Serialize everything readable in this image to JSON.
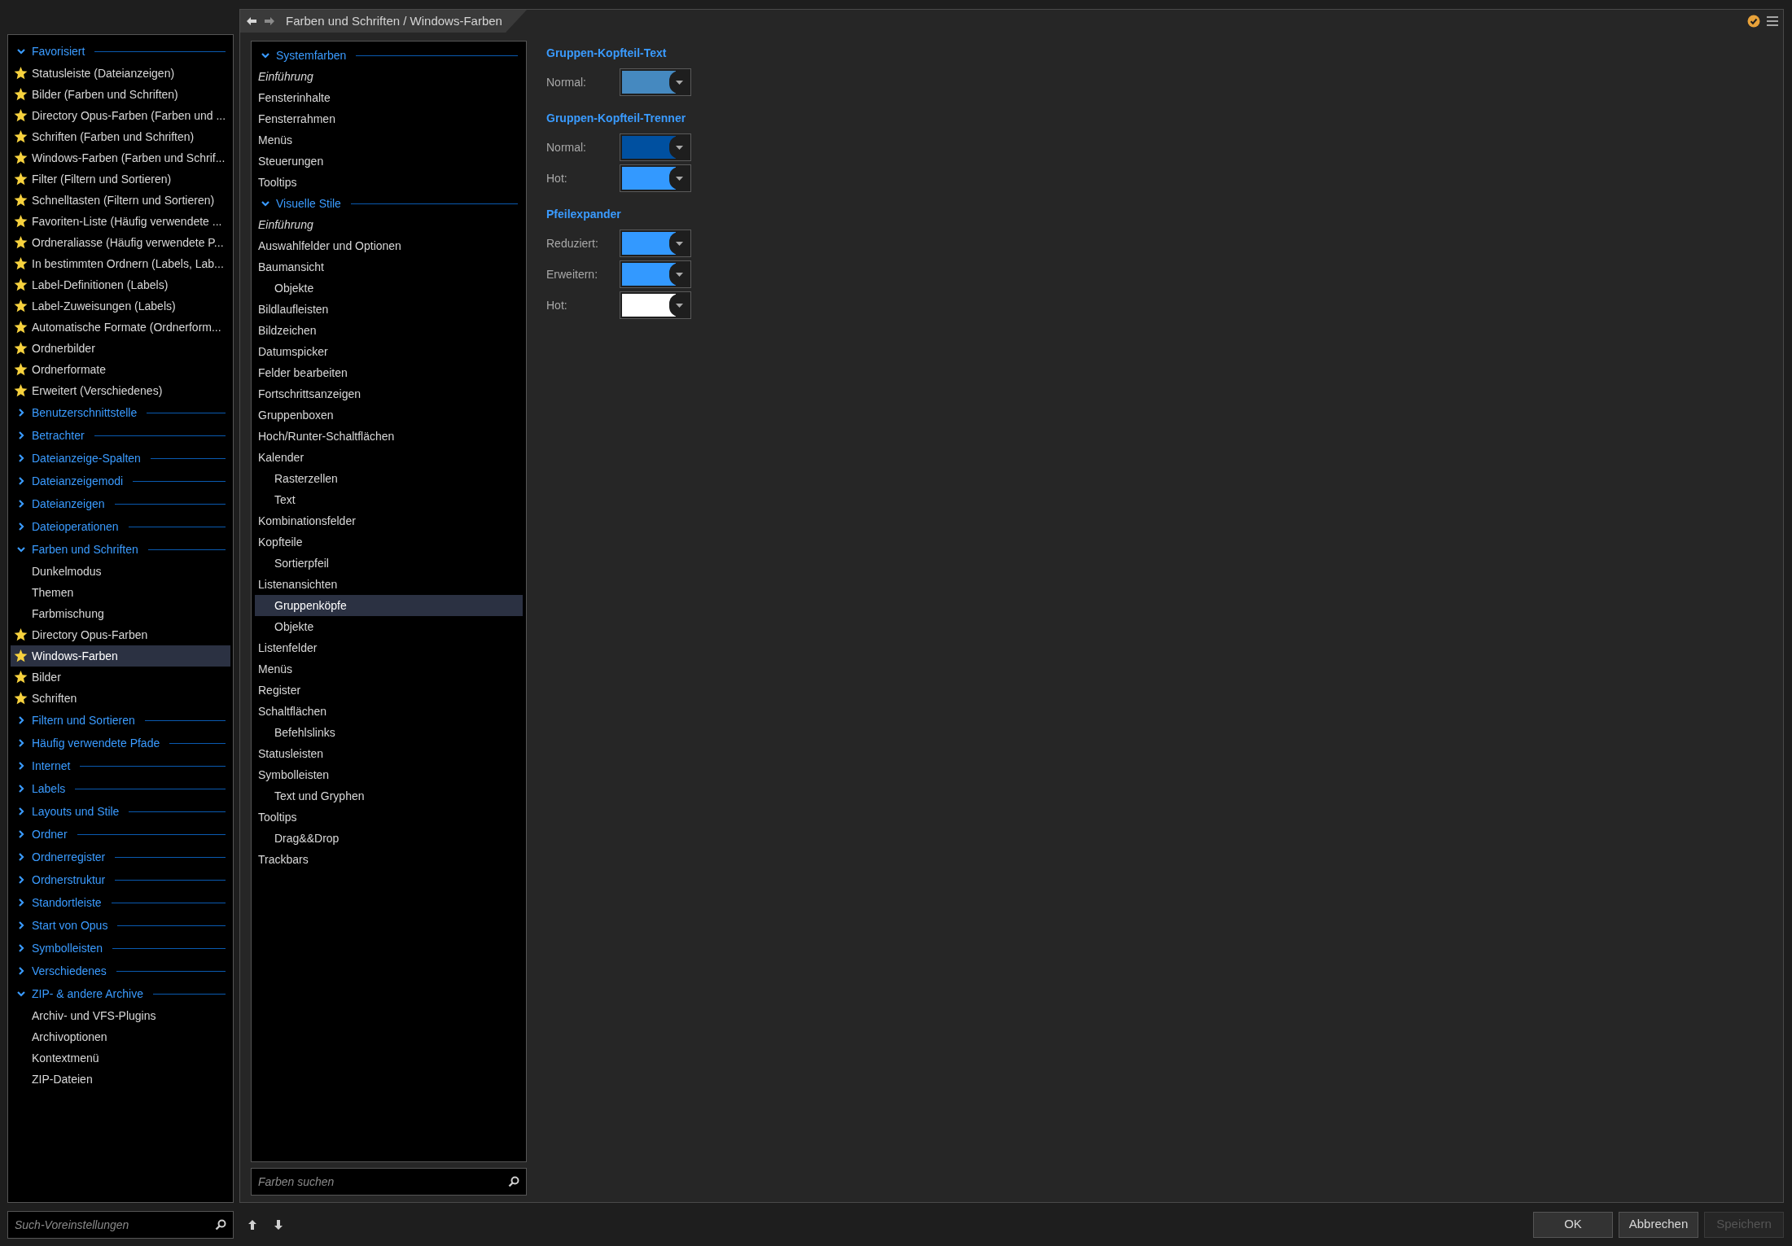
{
  "sidebar": {
    "items": [
      {
        "label": "Favorisiert",
        "expanded": true,
        "children": [
          {
            "label": "Statusleiste (Dateianzeigen)",
            "favorite": true,
            "selected": false
          },
          {
            "label": "Bilder (Farben und Schriften)",
            "favorite": true,
            "selected": false
          },
          {
            "label": "Directory Opus-Farben (Farben und ...",
            "favorite": true,
            "selected": false
          },
          {
            "label": "Schriften (Farben und Schriften)",
            "favorite": true,
            "selected": false
          },
          {
            "label": "Windows-Farben (Farben und Schrif...",
            "favorite": true,
            "selected": false
          },
          {
            "label": "Filter (Filtern und Sortieren)",
            "favorite": true,
            "selected": false
          },
          {
            "label": "Schnelltasten (Filtern und Sortieren)",
            "favorite": true,
            "selected": false
          },
          {
            "label": "Favoriten-Liste (Häufig verwendete ...",
            "favorite": true,
            "selected": false
          },
          {
            "label": "Ordneraliasse (Häufig verwendete P...",
            "favorite": true,
            "selected": false
          },
          {
            "label": "In bestimmten Ordnern (Labels, Lab...",
            "favorite": true,
            "selected": false
          },
          {
            "label": "Label-Definitionen (Labels)",
            "favorite": true,
            "selected": false
          },
          {
            "label": "Label-Zuweisungen (Labels)",
            "favorite": true,
            "selected": false
          },
          {
            "label": "Automatische Formate (Ordnerform...",
            "favorite": true,
            "selected": false
          },
          {
            "label": "Ordnerbilder",
            "favorite": true,
            "selected": false
          },
          {
            "label": "Ordnerformate",
            "favorite": true,
            "selected": false
          },
          {
            "label": "Erweitert (Verschiedenes)",
            "favorite": true,
            "selected": false
          }
        ]
      },
      {
        "label": "Benutzerschnittstelle",
        "expanded": false
      },
      {
        "label": "Betrachter",
        "expanded": false
      },
      {
        "label": "Dateianzeige-Spalten",
        "expanded": false
      },
      {
        "label": "Dateianzeigemodi",
        "expanded": false
      },
      {
        "label": "Dateianzeigen",
        "expanded": false
      },
      {
        "label": "Dateioperationen",
        "expanded": false
      },
      {
        "label": "Farben und Schriften",
        "expanded": true,
        "children": [
          {
            "label": "Dunkelmodus",
            "favorite": false,
            "selected": false
          },
          {
            "label": "Themen",
            "favorite": false,
            "selected": false
          },
          {
            "label": "Farbmischung",
            "favorite": false,
            "selected": false
          },
          {
            "label": "Directory Opus-Farben",
            "favorite": true,
            "selected": false
          },
          {
            "label": "Windows-Farben",
            "favorite": true,
            "selected": true
          },
          {
            "label": "Bilder",
            "favorite": true,
            "selected": false
          },
          {
            "label": "Schriften",
            "favorite": true,
            "selected": false
          }
        ]
      },
      {
        "label": "Filtern und Sortieren",
        "expanded": false
      },
      {
        "label": "Häufig verwendete Pfade",
        "expanded": false
      },
      {
        "label": "Internet",
        "expanded": false
      },
      {
        "label": "Labels",
        "expanded": false
      },
      {
        "label": "Layouts und Stile",
        "expanded": false
      },
      {
        "label": "Ordner",
        "expanded": false
      },
      {
        "label": "Ordnerregister",
        "expanded": false
      },
      {
        "label": "Ordnerstruktur",
        "expanded": false
      },
      {
        "label": "Standortleiste",
        "expanded": false
      },
      {
        "label": "Start von Opus",
        "expanded": false
      },
      {
        "label": "Symbolleisten",
        "expanded": false
      },
      {
        "label": "Verschiedenes",
        "expanded": false
      },
      {
        "label": "ZIP- & andere Archive",
        "expanded": true,
        "children": [
          {
            "label": "Archiv- und VFS-Plugins",
            "favorite": false,
            "selected": false
          },
          {
            "label": "Archivoptionen",
            "favorite": false,
            "selected": false
          },
          {
            "label": "Kontextmenü",
            "favorite": false,
            "selected": false
          },
          {
            "label": "ZIP-Dateien",
            "favorite": false,
            "selected": false
          }
        ]
      }
    ]
  },
  "preset_search": {
    "placeholder": "Such-Voreinstellungen"
  },
  "nav": {
    "back_disabled": false,
    "forward_disabled": true
  },
  "breadcrumb": "Farben und Schriften / Windows-Farben",
  "tree": {
    "items": [
      {
        "label": "Systemfarben",
        "expanded": true,
        "children": [
          {
            "kind": "intro",
            "label": "Einführung",
            "selected": false
          },
          {
            "kind": "page",
            "label": "Fensterinhalte",
            "selected": false
          },
          {
            "kind": "page",
            "label": "Fensterrahmen",
            "selected": false
          },
          {
            "kind": "page",
            "label": "Menüs",
            "selected": false
          },
          {
            "kind": "page",
            "label": "Steuerungen",
            "selected": false
          },
          {
            "kind": "page",
            "label": "Tooltips",
            "selected": false
          }
        ]
      },
      {
        "label": "Visuelle Stile",
        "expanded": true,
        "children": [
          {
            "kind": "intro",
            "label": "Einführung",
            "selected": false
          },
          {
            "kind": "page",
            "label": "Auswahlfelder und Optionen",
            "selected": false
          },
          {
            "kind": "page",
            "label": "Baumansicht",
            "selected": false,
            "children": [
              {
                "kind": "page",
                "label": "Objekte",
                "selected": false
              }
            ]
          },
          {
            "kind": "page",
            "label": "Bildlaufleisten",
            "selected": false
          },
          {
            "kind": "page",
            "label": "Bildzeichen",
            "selected": false
          },
          {
            "kind": "page",
            "label": "Datumspicker",
            "selected": false
          },
          {
            "kind": "page",
            "label": "Felder bearbeiten",
            "selected": false
          },
          {
            "kind": "page",
            "label": "Fortschrittsanzeigen",
            "selected": false
          },
          {
            "kind": "page",
            "label": "Gruppenboxen",
            "selected": false
          },
          {
            "kind": "page",
            "label": "Hoch/Runter-Schaltflächen",
            "selected": false
          },
          {
            "kind": "page",
            "label": "Kalender",
            "selected": false,
            "children": [
              {
                "kind": "page",
                "label": "Rasterzellen",
                "selected": false
              },
              {
                "kind": "page",
                "label": "Text",
                "selected": false
              }
            ]
          },
          {
            "kind": "page",
            "label": "Kombinationsfelder",
            "selected": false
          },
          {
            "kind": "page",
            "label": "Kopfteile",
            "selected": false,
            "children": [
              {
                "kind": "page",
                "label": "Sortierpfeil",
                "selected": false
              }
            ]
          },
          {
            "kind": "page",
            "label": "Listenansichten",
            "selected": false,
            "children": [
              {
                "kind": "page",
                "label": "Gruppenköpfe",
                "selected": true
              },
              {
                "kind": "page",
                "label": "Objekte",
                "selected": false
              }
            ]
          },
          {
            "kind": "page",
            "label": "Listenfelder",
            "selected": false
          },
          {
            "kind": "page",
            "label": "Menüs",
            "selected": false
          },
          {
            "kind": "page",
            "label": "Register",
            "selected": false
          },
          {
            "kind": "page",
            "label": "Schaltflächen",
            "selected": false,
            "children": [
              {
                "kind": "page",
                "label": "Befehlslinks",
                "selected": false
              }
            ]
          },
          {
            "kind": "page",
            "label": "Statusleisten",
            "selected": false
          },
          {
            "kind": "page",
            "label": "Symbolleisten",
            "selected": false,
            "children": [
              {
                "kind": "page",
                "label": "Text und Gryphen",
                "selected": false
              }
            ]
          },
          {
            "kind": "page",
            "label": "Tooltips",
            "selected": false,
            "children": [
              {
                "kind": "page",
                "label": "Drag&&Drop",
                "selected": false
              }
            ]
          },
          {
            "kind": "page",
            "label": "Trackbars",
            "selected": false
          }
        ]
      }
    ]
  },
  "color_search": {
    "placeholder": "Farben suchen"
  },
  "sections": [
    {
      "title": "Gruppen-Kopfteil-Text",
      "rows": [
        {
          "label": "Normal:",
          "color": "#4589c0"
        }
      ]
    },
    {
      "title": "Gruppen-Kopfteil-Trenner",
      "rows": [
        {
          "label": "Normal:",
          "color": "#0050a0"
        },
        {
          "label": "Hot:",
          "color": "#3399ff"
        }
      ]
    },
    {
      "title": "Pfeilexpander",
      "rows": [
        {
          "label": "Reduziert:",
          "color": "#3399ff"
        },
        {
          "label": "Erweitern:",
          "color": "#3399ff"
        },
        {
          "label": "Hot:",
          "color": "#ffffff"
        }
      ]
    }
  ],
  "buttons": [
    {
      "label": "OK",
      "disabled": false
    },
    {
      "label": "Abbrechen",
      "disabled": false
    },
    {
      "label": "Speichern",
      "disabled": true
    }
  ]
}
